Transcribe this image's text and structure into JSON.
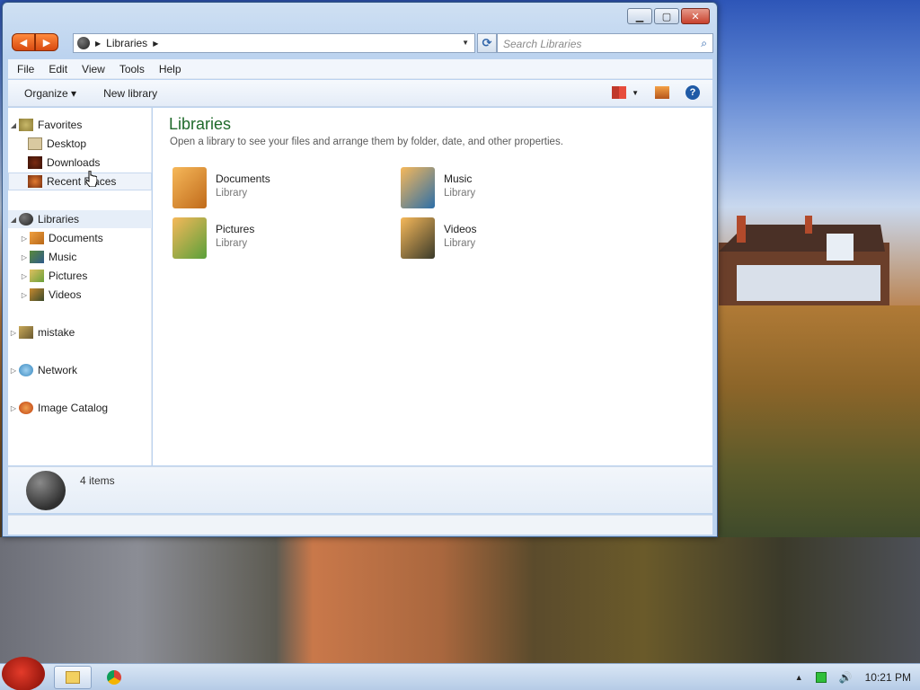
{
  "window": {
    "address": {
      "crumb": "Libraries"
    },
    "search": {
      "placeholder": "Search Libraries"
    }
  },
  "menu": [
    "File",
    "Edit",
    "View",
    "Tools",
    "Help"
  ],
  "toolbar": {
    "organize": "Organize",
    "new_library": "New library"
  },
  "navpane": {
    "favorites": "Favorites",
    "fav_items": [
      "Desktop",
      "Downloads",
      "Recent Places"
    ],
    "libraries": "Libraries",
    "lib_items": [
      "Documents",
      "Music",
      "Pictures",
      "Videos"
    ],
    "mistake": "mistake",
    "network": "Network",
    "catalog": "Image Catalog"
  },
  "content": {
    "title": "Libraries",
    "subtitle": "Open a library to see your files and arrange them by folder, date, and other properties.",
    "items": [
      {
        "name": "Documents",
        "type": "Library"
      },
      {
        "name": "Music",
        "type": "Library"
      },
      {
        "name": "Pictures",
        "type": "Library"
      },
      {
        "name": "Videos",
        "type": "Library"
      }
    ]
  },
  "details": {
    "count": "4 items"
  },
  "taskbar": {
    "clock": "10:21 PM"
  },
  "colors": {
    "accent": "#1f5aa6",
    "heading": "#1f6a2a",
    "nav_orange": "#e8601e"
  },
  "icons": [
    "back-icon",
    "forward-icon",
    "refresh-icon",
    "search-icon",
    "help-icon",
    "folder-icon",
    "star-icon",
    "network-icon"
  ]
}
